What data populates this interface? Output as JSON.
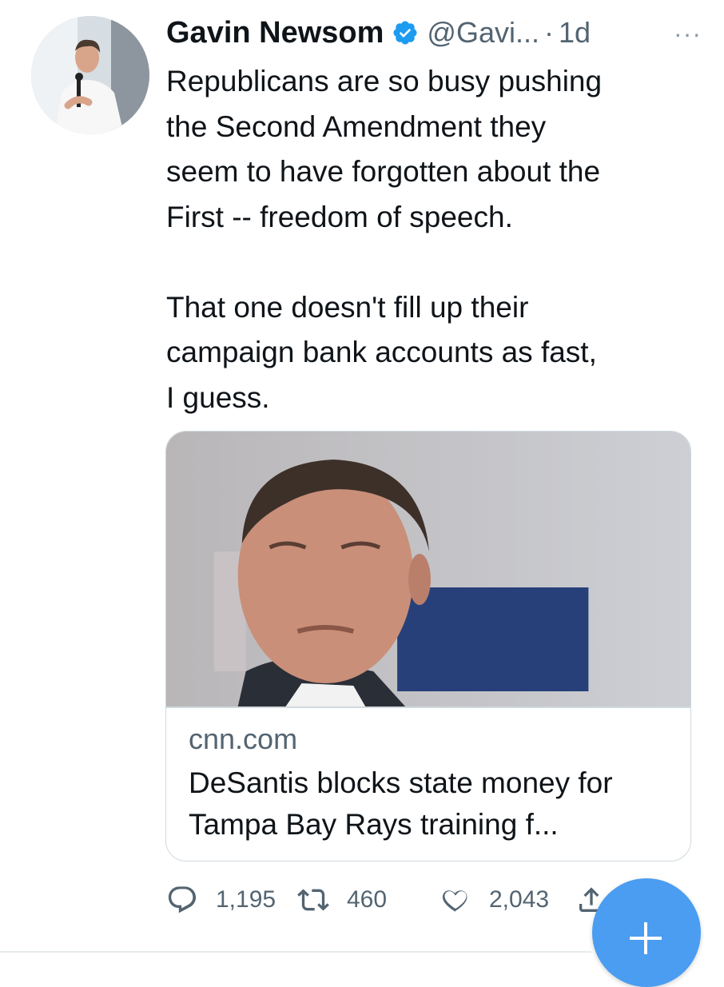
{
  "tweet": {
    "author_name": "Gavin Newsom",
    "handle": "@Gavi...",
    "separator": "·",
    "time": "1d",
    "more_label": "···",
    "verified_icon": "verified-badge-icon",
    "text": "Republicans are so busy pushing\nthe Second Amendment they\nseem to have forgotten about the\nFirst -- freedom of speech.\n\nThat one doesn't fill up their\ncampaign bank accounts as fast,\nI guess."
  },
  "card": {
    "domain": "cnn.com",
    "title": "DeSantis blocks state money for Tampa Bay Rays training f..."
  },
  "actions": {
    "reply_count": "1,195",
    "retweet_count": "460",
    "like_count": "2,043"
  },
  "colors": {
    "accent": "#1d9bf0",
    "fab": "#4a9df0",
    "secondary_text": "#536471"
  }
}
